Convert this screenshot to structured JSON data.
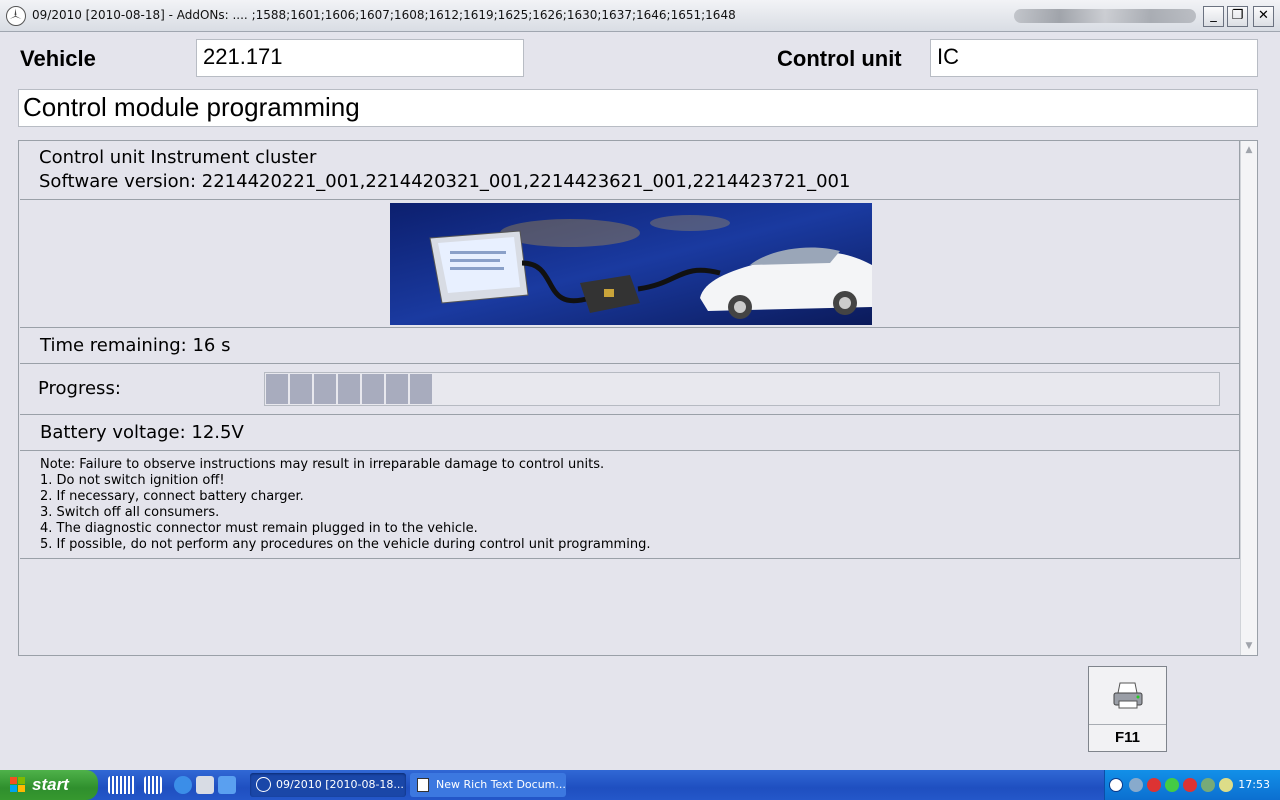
{
  "window": {
    "title": "09/2010 [2010-08-18] - AddONs:  .... ;1588;1601;1606;1607;1608;1612;1619;1625;1626;1630;1637;1646;1651;1648",
    "min_label": "_",
    "restore_label": "❐",
    "close_label": "✕"
  },
  "header": {
    "vehicle_label": "Vehicle",
    "vehicle_value": "221.171",
    "control_unit_label": "Control unit",
    "control_unit_value": "IC",
    "page_title": "Control module programming"
  },
  "info": {
    "unit_line": "Control unit Instrument cluster",
    "software_line": "Software version: 2214420221_001,2214420321_001,2214423621_001,2214423721_001"
  },
  "status": {
    "time_remaining": "Time remaining: 16 s",
    "progress_label": "Progress:",
    "progress_fraction": 0.18,
    "battery_voltage": "Battery voltage: 12.5V"
  },
  "note": {
    "lines": [
      "Note:  Failure to observe instructions may result in irreparable damage to control units.",
      "1. Do not switch ignition off!",
      "2. If necessary, connect battery charger.",
      "3. Switch off all consumers.",
      "4. The diagnostic connector must remain plugged in to the vehicle.",
      "5. If possible, do not perform any procedures on the vehicle during control unit programming."
    ]
  },
  "actions": {
    "print_key": "F11"
  },
  "taskbar": {
    "start_label": "start",
    "tasks": [
      {
        "label": "09/2010 [2010-08-18..."
      },
      {
        "label": "New Rich Text Docum..."
      }
    ],
    "clock": "17:53"
  },
  "colors": {
    "progress_segment": "#a8acbe",
    "taskbar": "#2457c9",
    "start_button": "#3a9a34"
  }
}
